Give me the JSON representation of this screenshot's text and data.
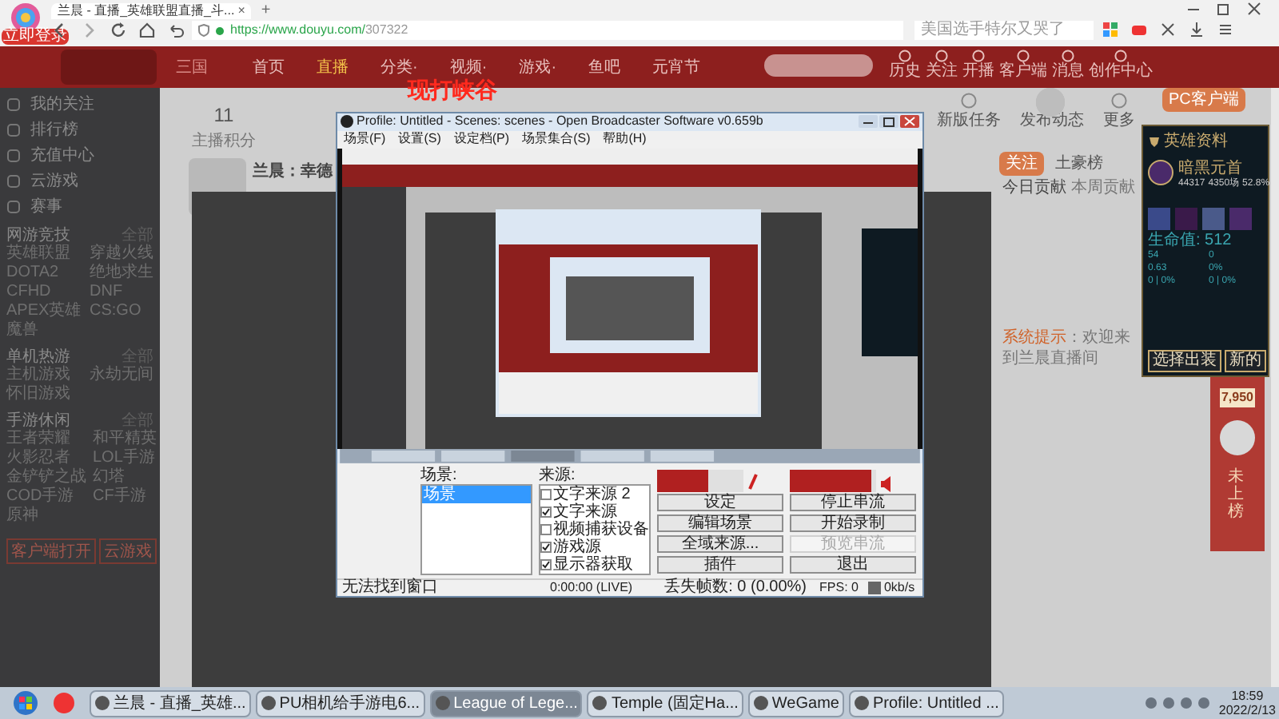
{
  "browser": {
    "badge": "立即登录",
    "tab": {
      "title": "兰晨 - 直播_英雄联盟直播_斗...",
      "close": "×"
    },
    "new_tab": "+",
    "url": {
      "host": "https://www.douyu.com/",
      "path": "307322"
    },
    "search": {
      "placeholder": "美国选手特尔又哭了"
    }
  },
  "site_header": {
    "logo_text": "三国",
    "nav": [
      {
        "label": "首页",
        "selected": false
      },
      {
        "label": "直播",
        "selected": true
      },
      {
        "label": "分类·",
        "selected": false
      },
      {
        "label": "视频·",
        "selected": false
      },
      {
        "label": "游戏·",
        "selected": false
      },
      {
        "label": "鱼吧",
        "selected": false
      },
      {
        "label": "元宵节",
        "selected": false
      }
    ],
    "overlay_caption": "现打峡谷",
    "tools": [
      "历史",
      "关注",
      "开播",
      "客户端",
      "消息",
      "创作中心"
    ]
  },
  "sidebar": {
    "items": [
      "我的关注",
      "排行榜",
      "充值中心",
      "云游戏",
      "赛事"
    ],
    "sections": [
      {
        "title": "网游竞技",
        "more": "全部",
        "games": [
          "英雄联盟",
          "穿越火线",
          "DOTA2",
          "绝地求生",
          "CFHD",
          "DNF",
          "APEX英雄",
          "CS:GO",
          "魔兽"
        ]
      },
      {
        "title": "单机热游",
        "more": "全部",
        "games": [
          "主机游戏",
          "永劫无间",
          "怀旧游戏"
        ]
      },
      {
        "title": "手游休闲",
        "more": "全部",
        "games": [
          "王者荣耀",
          "和平精英",
          "火影忍者",
          "LOL手游",
          "金铲铲之战",
          "幻塔",
          "COD手游",
          "CF手游",
          "原神"
        ]
      }
    ],
    "buttons": [
      "客户端打开",
      "云游戏"
    ]
  },
  "room": {
    "stats": [
      {
        "value": "11",
        "label": "主播积分"
      }
    ],
    "streamer": "兰晨：幸德",
    "actions": [
      "新版任务",
      "发布动态",
      "更多"
    ],
    "client_button": "PC客户端",
    "follow": "关注",
    "rank_title": "土豪榜",
    "rank_tabs": [
      {
        "label": "今日贡献",
        "selected": true
      },
      {
        "label": "本周贡献",
        "selected": false
      }
    ],
    "notice_label": "系统提示",
    "notice": "：欢迎来到兰晨直播间"
  },
  "obs": {
    "title": "Profile: Untitled - Scenes: scenes - Open Broadcaster Software v0.659b",
    "menu": [
      "场景(F)",
      "设置(S)",
      "设定档(P)",
      "场景集合(S)",
      "帮助(H)"
    ],
    "scenes_label": "场景:",
    "scenes": [
      {
        "label": "场景",
        "selected": true
      }
    ],
    "sources_label": "来源:",
    "sources": [
      {
        "label": "文字来源 2",
        "checked": false
      },
      {
        "label": "文字来源",
        "checked": true
      },
      {
        "label": "视频捕获设备",
        "checked": false
      },
      {
        "label": "游戏源",
        "checked": true
      },
      {
        "label": "显示器获取",
        "checked": true
      }
    ],
    "meters": [
      {
        "kind": "mic",
        "level": 0.6
      },
      {
        "kind": "speaker",
        "level": 0.95
      }
    ],
    "buttons": [
      {
        "label": "设定",
        "disabled": false
      },
      {
        "label": "停止串流",
        "disabled": false
      },
      {
        "label": "编辑场景",
        "disabled": false
      },
      {
        "label": "开始录制",
        "disabled": false
      },
      {
        "label": "全域来源...",
        "disabled": false
      },
      {
        "label": "预览串流",
        "disabled": true
      },
      {
        "label": "插件",
        "disabled": false
      },
      {
        "label": "退出",
        "disabled": false
      }
    ],
    "status": {
      "message": "无法找到窗口",
      "time": "0:00:00 (LIVE)",
      "dropped": "丢失帧数: 0 (0.00%)",
      "fps": "FPS: 0",
      "bitrate": "0kb/s"
    }
  },
  "hero_panel": {
    "title": "英雄资料",
    "hero": "暗黑元首",
    "stats": [
      "44317",
      "4350场",
      "52.8%"
    ],
    "health": "生命值: 512",
    "attributes": [
      "54",
      "0",
      "0.63",
      "0%",
      "0 | 0%",
      "0 | 0%"
    ],
    "buttons": [
      "选择出装",
      "新的"
    ]
  },
  "promo": {
    "value": "7,950",
    "caption": "未上榜"
  },
  "taskbar": {
    "windows": [
      {
        "label": "兰晨 - 直播_英雄...",
        "selected": false
      },
      {
        "label": "PU相机给手游电6...",
        "selected": false
      },
      {
        "label": "League of Lege...",
        "selected": true
      },
      {
        "label": "Temple (固定Ha...",
        "selected": false
      },
      {
        "label": "WeGame",
        "selected": false
      },
      {
        "label": "Profile: Untitled ...",
        "selected": false
      }
    ],
    "time": "18:59",
    "date": "2022/2/13"
  }
}
